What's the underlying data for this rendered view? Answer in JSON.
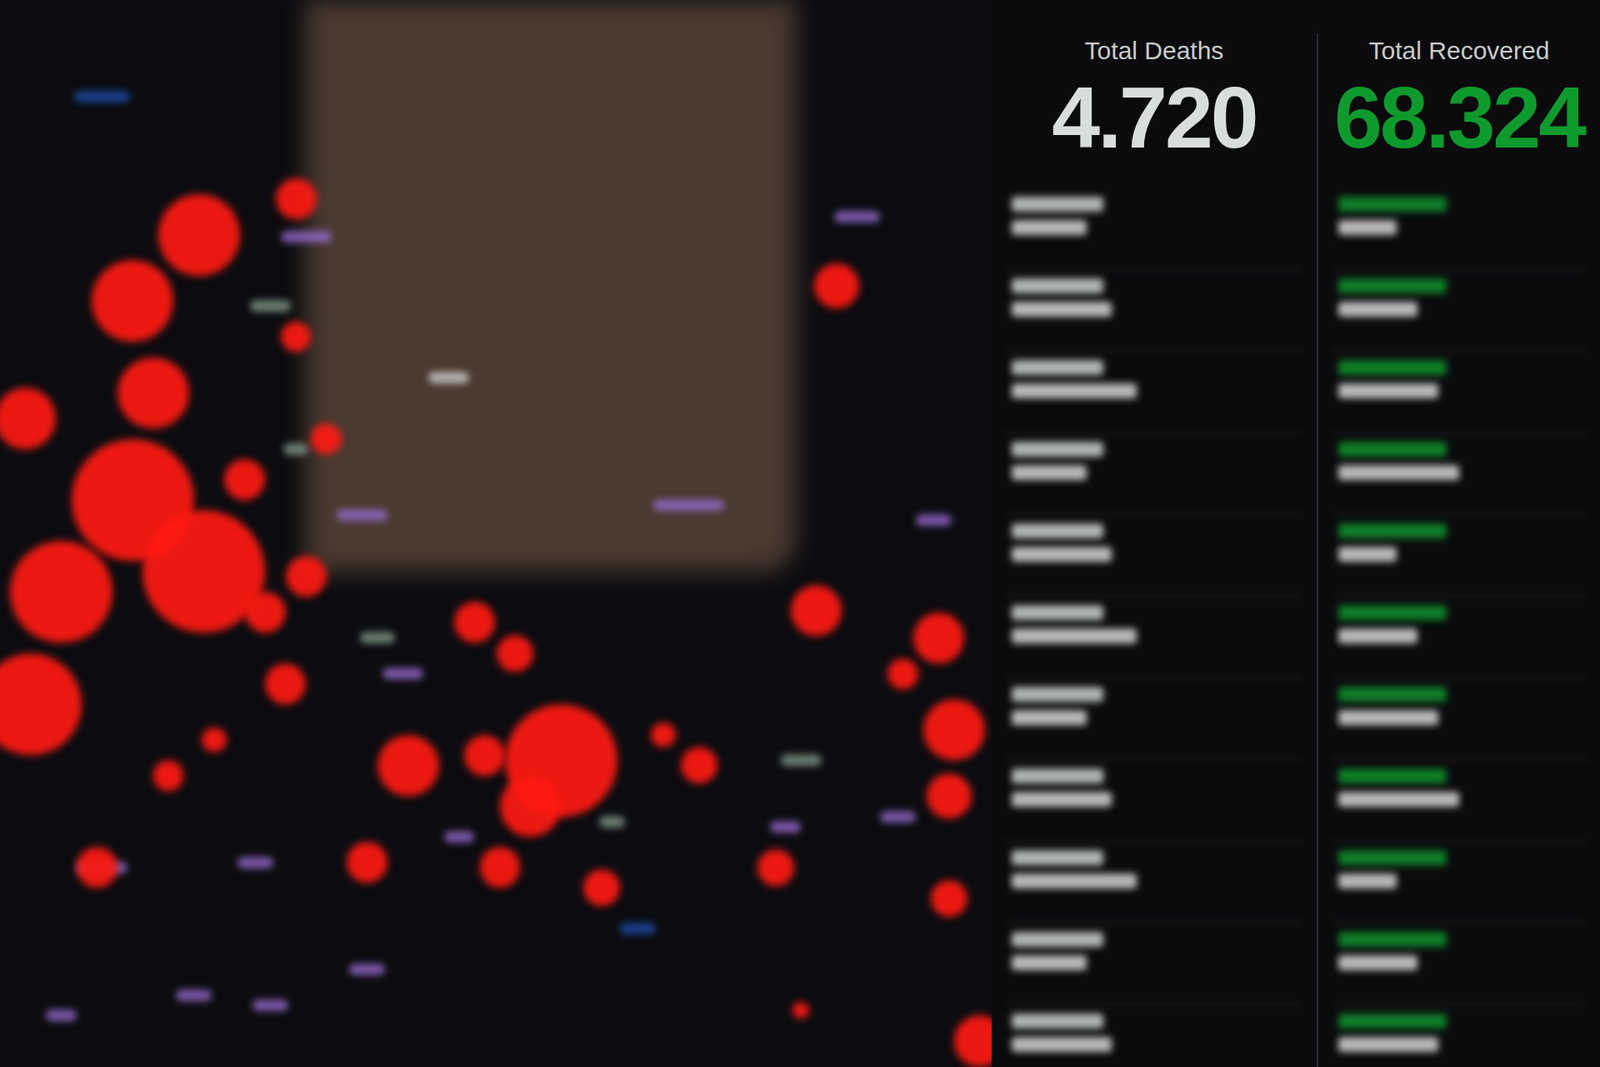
{
  "panels": [
    {
      "title": "Total Deaths",
      "value": "4.720",
      "color": "#d9dedb",
      "rows": [
        {
          "blurred": true
        },
        {
          "blurred": true
        },
        {
          "blurred": true
        },
        {
          "blurred": true
        },
        {
          "blurred": true
        },
        {
          "blurred": true
        },
        {
          "blurred": true
        },
        {
          "blurred": true
        },
        {
          "blurred": true
        },
        {
          "blurred": true
        },
        {
          "blurred": true
        }
      ]
    },
    {
      "title": "Total Recovered",
      "value": "68.324",
      "color": "#0f9a2e",
      "rows": [
        {
          "blurred": true
        },
        {
          "blurred": true
        },
        {
          "blurred": true
        },
        {
          "blurred": true
        },
        {
          "blurred": true
        },
        {
          "blurred": true
        },
        {
          "blurred": true
        },
        {
          "blurred": true
        },
        {
          "blurred": true
        },
        {
          "blurred": true
        },
        {
          "blurred": true
        }
      ]
    }
  ]
}
